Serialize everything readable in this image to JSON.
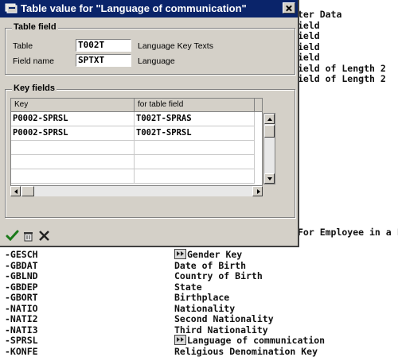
{
  "dialog": {
    "title": "Table value for \"Language of communication\"",
    "table_field_group": "Table field",
    "table_label": "Table",
    "table_value": "T002T",
    "table_desc": "Language Key Texts",
    "fieldname_label": "Field name",
    "fieldname_value": "SPTXT",
    "fieldname_desc": "Language",
    "key_fields_group": "Key fields",
    "columns": [
      "Key",
      "for table field"
    ],
    "rows": [
      {
        "key": "P0002-SPRSL",
        "field": "T002T-SPRAS"
      },
      {
        "key": "P0002-SPRSL",
        "field": "T002T-SPRSL"
      }
    ]
  },
  "background": {
    "right_lines": [
      "ter Data",
      "ield",
      "ield",
      "ield",
      "ield",
      "ield of Length 2",
      "ield of Length 2"
    ],
    "right_extra": "For Employee in a L",
    "rows": [
      {
        "field": "-GESCH",
        "desc": "Gender Key",
        "marked": true
      },
      {
        "field": "-GBDAT",
        "desc": "Date of Birth",
        "marked": false
      },
      {
        "field": "-GBLND",
        "desc": "Country of Birth",
        "marked": false
      },
      {
        "field": "-GBDEP",
        "desc": "State",
        "marked": false
      },
      {
        "field": "-GBORT",
        "desc": "Birthplace",
        "marked": false
      },
      {
        "field": "-NATIO",
        "desc": "Nationality",
        "marked": false
      },
      {
        "field": "-NATI2",
        "desc": "Second Nationality",
        "marked": false
      },
      {
        "field": "-NATI3",
        "desc": "Third Nationality",
        "marked": false
      },
      {
        "field": "-SPRSL",
        "desc": "Language of communication",
        "marked": true
      },
      {
        "field": "-KONFE",
        "desc": "Religious Denomination Key",
        "marked": false
      }
    ]
  },
  "colors": {
    "titlebar": "#0a246a",
    "dialog_bg": "#d4d0c8"
  },
  "icons": [
    "sap-window-icon",
    "close-icon",
    "checkmark-icon",
    "trash-icon",
    "cancel-x-icon"
  ]
}
